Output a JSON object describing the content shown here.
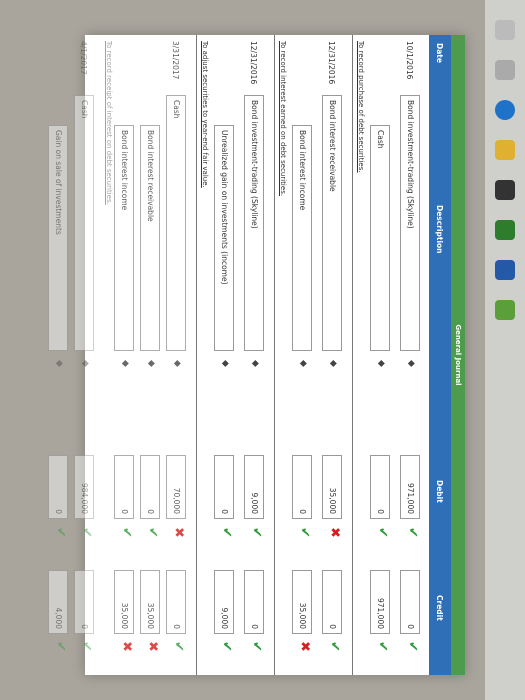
{
  "journal_title": "General Journal",
  "headers": {
    "date": "Date",
    "description": "Description",
    "debit": "Debit",
    "credit": "Credit"
  },
  "entries": [
    {
      "date": "10/1/2016",
      "desc": "Bond investment-trading (Skyline)",
      "debit": "971,000",
      "credit": "0",
      "debit_status": "correct",
      "credit_status": "correct"
    },
    {
      "date": "",
      "desc": "Cash",
      "debit": "0",
      "credit": "971,000",
      "debit_status": "correct",
      "credit_status": "correct"
    },
    {
      "date": "12/31/2016",
      "desc": "Bond interest receivable",
      "debit": "35,000",
      "credit": "0",
      "debit_status": "incorrect",
      "credit_status": "correct"
    },
    {
      "date": "",
      "desc": "Bond interest income",
      "debit": "0",
      "credit": "35,000",
      "debit_status": "correct",
      "credit_status": "incorrect"
    },
    {
      "date": "12/31/2016",
      "desc": "Bond investment-trading (Skyline)",
      "debit": "9,000",
      "credit": "0",
      "debit_status": "correct",
      "credit_status": "correct"
    },
    {
      "date": "",
      "desc": "Unrealized gain on investments (income)",
      "debit": "0",
      "credit": "9,000",
      "debit_status": "correct",
      "credit_status": "correct"
    },
    {
      "date": "3/31/2017",
      "desc": "Cash",
      "debit": "70,000",
      "credit": "0",
      "debit_status": "incorrect",
      "credit_status": "correct"
    },
    {
      "date": "",
      "desc": "Bond interest receivable",
      "debit": "0",
      "credit": "35,000",
      "debit_status": "correct",
      "credit_status": "incorrect"
    },
    {
      "date": "",
      "desc": "Bond interest income",
      "debit": "0",
      "credit": "35,000",
      "debit_status": "correct",
      "credit_status": "incorrect"
    },
    {
      "date": "4/1/2017",
      "desc": "Cash",
      "debit": "984,000",
      "credit": "0",
      "debit_status": "correct",
      "credit_status": "correct"
    },
    {
      "date": "",
      "desc": "Gain on sale of investments",
      "debit": "0",
      "credit": "4,000",
      "debit_status": "correct",
      "credit_status": "correct"
    }
  ],
  "notes": [
    "To record purchase of debt securities.",
    "To record interest earned on debt securities.",
    "To adjust securities to year-end fair value.",
    "To record receipt of interest on debt securities."
  ],
  "marks": {
    "correct": "✔",
    "incorrect": "✖"
  },
  "colors": {
    "header": "#2f6fb8",
    "title_bar": "#4d9c4e",
    "correct": "#2e9c3a",
    "incorrect": "#d41e1e"
  }
}
